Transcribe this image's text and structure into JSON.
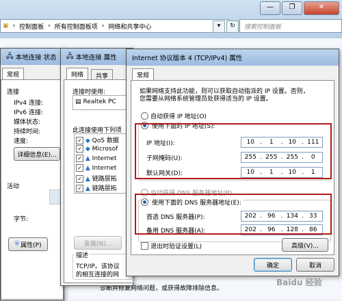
{
  "explorer": {
    "breadcrumb": [
      "控制面板",
      "所有控制面板项",
      "网络和共享中心"
    ],
    "search_placeholder": "搜索控制面板",
    "min_glyph": "—",
    "max_glyph": "❐",
    "close_glyph": "✕"
  },
  "status_dialog": {
    "title": "本地连接 状态",
    "tab": "常规",
    "connection_heading": "连接",
    "rows": [
      "IPv4 连接:",
      "IPv6 连接:",
      "媒体状态:",
      "持续时间:",
      "速度:"
    ],
    "details_button": "详细信息(E)...",
    "activity_heading": "活动",
    "bytes_label": "字节:",
    "properties_button": "属性(P)"
  },
  "props_dialog": {
    "title": "本地连接 属性",
    "tabs": [
      "网络",
      "共享"
    ],
    "connect_using_label": "连接时使用:",
    "adapter": "Realtek PC",
    "items_label": "此连接使用下列项",
    "items": [
      "QoS 数据",
      "Microsof",
      "Internet",
      "Internet",
      "链路层拓",
      "链路层拓"
    ],
    "install_button": "安装(N)...",
    "description_label": "描述",
    "description_text": "TCP/IP。该协议",
    "description_text2": "的相互连接的网"
  },
  "ipv4_dialog": {
    "title": "Internet 协议版本 4 (TCP/IPv4) 属性",
    "tab": "常规",
    "intro_line1": "如果网络支持此功能，则可以获取自动指派的 IP 设置。否则，",
    "intro_line2": "您需要从网络系统管理员处获得适当的 IP 设置。",
    "auto_ip_label": "自动获得 IP 地址(O)",
    "manual_ip_label": "使用下面的 IP 地址(S):",
    "ip_label": "IP 地址(I):",
    "ip_address": [
      "10",
      "1",
      "10",
      "111"
    ],
    "mask_label": "子网掩码(U):",
    "subnet_mask": [
      "255",
      "255",
      "255",
      "0"
    ],
    "gateway_label": "默认网关(D):",
    "gateway": [
      "10",
      "1",
      "10",
      "1"
    ],
    "auto_dns_label": "自动获得 DNS 服务器地址(B)",
    "manual_dns_label": "使用下面的 DNS 服务器地址(E):",
    "pref_dns_label": "首选 DNS 服务器(P):",
    "preferred_dns": [
      "202",
      "96",
      "134",
      "33"
    ],
    "alt_dns_label": "备用 DNS 服务器(A):",
    "alternate_dns": [
      "202",
      "96",
      "128",
      "86"
    ],
    "validate_label": "退出时验证设置(L)",
    "advanced_button": "高级(V)...",
    "ok_button": "确定",
    "cancel_button": "取消"
  },
  "footer_text": "诊断并修复网络问题，或获得故障排除信息。",
  "watermark": "Baidu 经验"
}
